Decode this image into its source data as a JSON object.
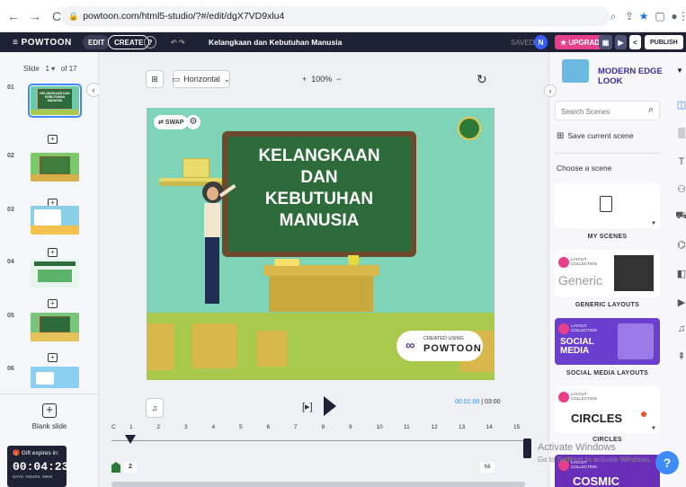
{
  "browser": {
    "url": "powtoon.com/html5-studio/?#/edit/dgX7VD9xlu4",
    "back": "←",
    "forward": "→",
    "reload": "C"
  },
  "header": {
    "logo": "≡ POWTOON",
    "edit": "EDIT",
    "create": "CREATE",
    "help": "?",
    "undo_redo": "↶ ↷",
    "title": "Kelangkaan dan Kebutuhan Manusia",
    "saved": "SAVED",
    "avatar": "N",
    "upgrade": "★ UPGRADE",
    "publish": "PUBLISH"
  },
  "slides": {
    "label": "Slide",
    "current": "1 ▾",
    "of": "of 17",
    "items": [
      {
        "num": "01",
        "title": "KELANGKAAN DAN KEBUTUHAN MANUSIA"
      },
      {
        "num": "02",
        "title": ""
      },
      {
        "num": "03",
        "title": ""
      },
      {
        "num": "04",
        "title": ""
      },
      {
        "num": "05",
        "title": ""
      },
      {
        "num": "06",
        "title": ""
      }
    ],
    "blank_icon": "+",
    "blank_label": "Blank slide",
    "gift_label": "Gift expires in:",
    "countdown": "00:04:23",
    "countdown_units": "DAYS  HOURS  MINS"
  },
  "toolbar": {
    "orientation": "Horizontal",
    "zoom": "+  100%  −"
  },
  "scene": {
    "board_text_1": "KELANGKAAN",
    "board_text_2": "DAN",
    "board_text_3": "KEBUTUHAN",
    "board_text_4": "MANUSIA",
    "swap": "⇄ SWAP",
    "created_using": "CREATED USING",
    "brand": "POWTOON"
  },
  "player": {
    "time": "00:01:00",
    "duration": "03:00",
    "ticks": [
      "C",
      "1",
      "2",
      "3",
      "4",
      "5",
      "6",
      "7",
      "8",
      "9",
      "10",
      "11",
      "12",
      "13",
      "14",
      "15"
    ],
    "layer_num": "2",
    "layer_end": "Nil"
  },
  "rightpanel": {
    "style_title": "MODERN EDGE LOOK",
    "search_placeholder": "Search Scenes",
    "save_scene": "Save current scene",
    "choose": "Choose a scene",
    "my_scenes": "MY SCENES",
    "layout_collection": "LAYOUT COLLECTION",
    "generic": "Generic",
    "generic_label": "GENERIC LAYOUTS",
    "social": "SOCIAL MEDIA",
    "social_label": "SOCIAL MEDIA LAYOUTS",
    "circles": "CIRCLES",
    "circles_label": "CIRCLES",
    "cosmic": "COSMIC",
    "activate_title": "Activate Windows",
    "activate_sub": "Go to Settings to activate Windows."
  },
  "colors": {
    "header_bg": "#1f2235",
    "upgrade": "#e83e8c",
    "accent": "#3d8bfd",
    "board": "#2e6b3a",
    "wall": "#7fd3b6"
  }
}
